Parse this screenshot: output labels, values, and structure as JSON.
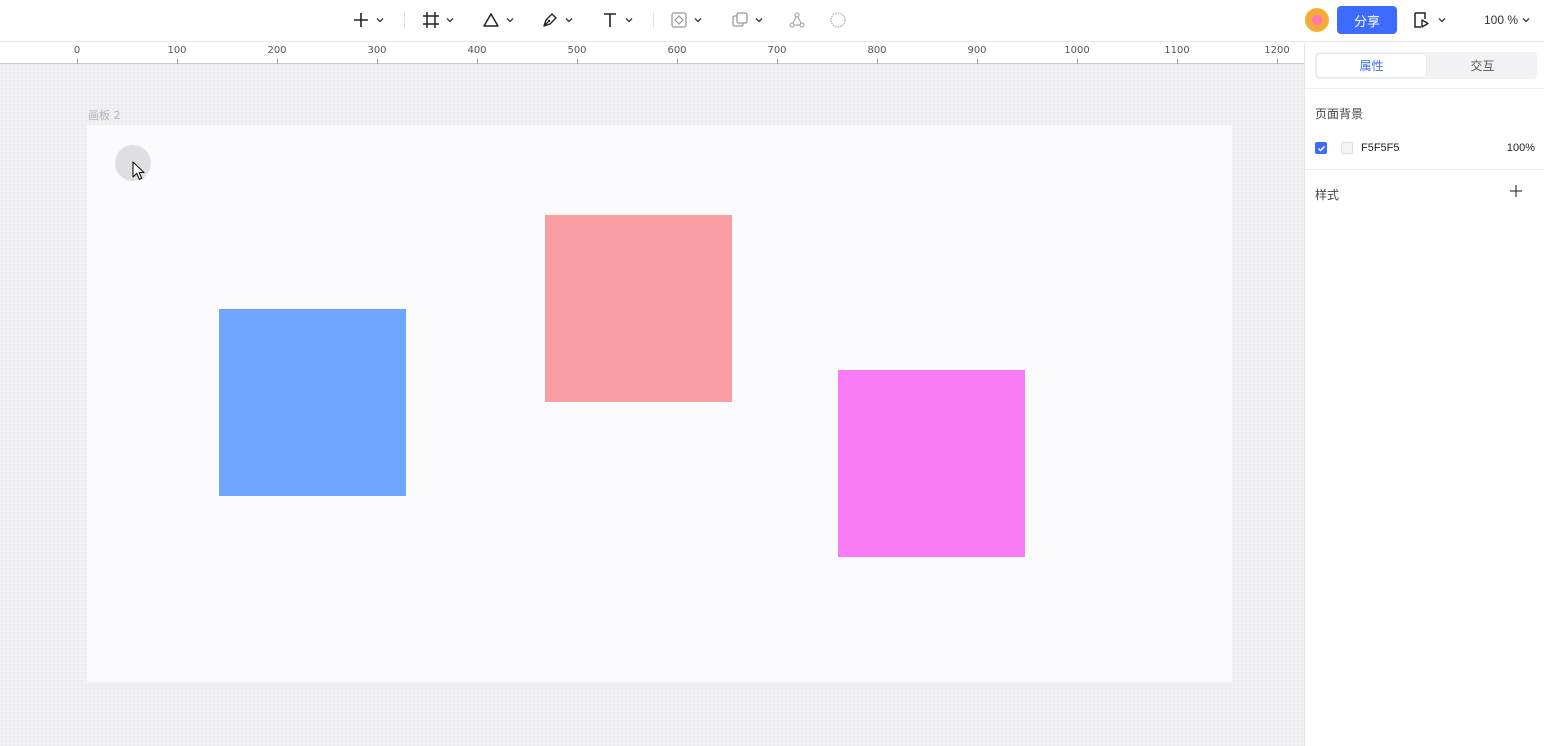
{
  "toolbar": {
    "tools": [
      {
        "name": "add-tool",
        "icon": "plus-icon"
      },
      {
        "name": "frame-tool",
        "icon": "frame-icon"
      },
      {
        "name": "shape-tool",
        "icon": "triangle-icon"
      },
      {
        "name": "pen-tool",
        "icon": "pen-icon"
      },
      {
        "name": "text-tool",
        "icon": "text-icon"
      },
      {
        "name": "component-tool",
        "icon": "component-icon"
      },
      {
        "name": "boolean-tool",
        "icon": "boolean-icon"
      },
      {
        "name": "connect-tool",
        "icon": "nodes-icon"
      },
      {
        "name": "mask-tool",
        "icon": "circle-icon"
      }
    ],
    "share_label": "分享",
    "zoom_label": "100 %"
  },
  "ruler": {
    "labels": [
      "0",
      "100",
      "200",
      "300",
      "400",
      "500",
      "600",
      "700",
      "800",
      "900",
      "1000",
      "1100",
      "1200"
    ]
  },
  "canvas": {
    "board_label": "画板 2",
    "shapes": [
      {
        "name": "blue-rectangle",
        "color": "#6ea6fd"
      },
      {
        "name": "red-rectangle",
        "color": "#fa9ea4"
      },
      {
        "name": "magenta-rectangle",
        "color": "#f77cf6"
      }
    ]
  },
  "panel": {
    "tabs": [
      {
        "label": "属性",
        "active": true
      },
      {
        "label": "交互",
        "active": false
      }
    ],
    "page_background_title": "页面背景",
    "background": {
      "checked": true,
      "color": "#F5F5F5",
      "hex": "F5F5F5",
      "opacity": "100%"
    },
    "style_title": "样式"
  },
  "colors": {
    "accent": "#3d6bff"
  }
}
